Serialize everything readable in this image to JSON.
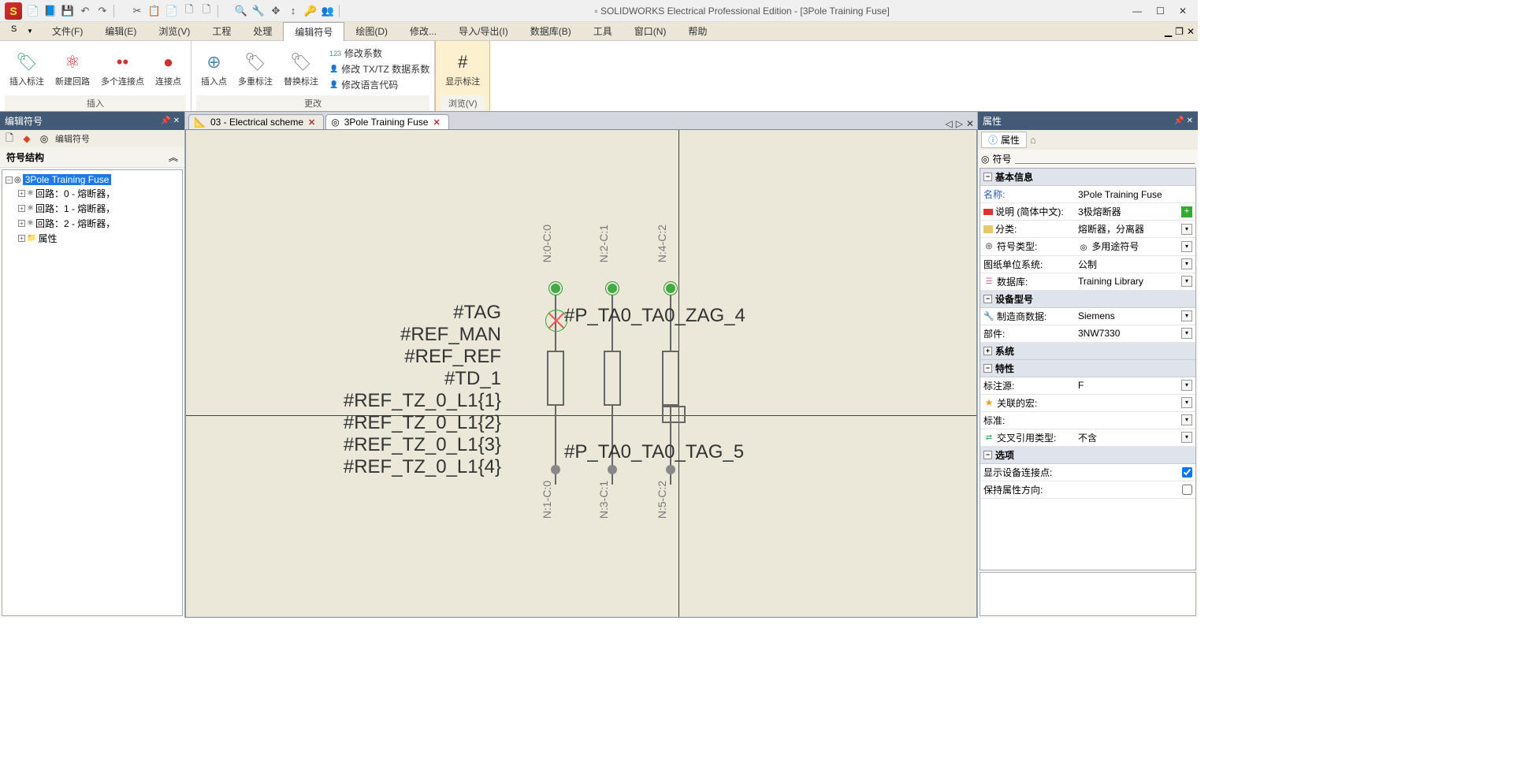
{
  "title": "SOLIDWORKS Electrical Professional Edition - [3Pole Training Fuse]",
  "quickAccess": [
    "📄",
    "📘",
    "💾",
    "↶",
    "↷",
    "",
    "✂",
    "📋",
    "📄",
    "🗋",
    "🗋",
    "",
    "🔍",
    "🔧",
    "✥",
    "↕",
    "🔑",
    "👥",
    ""
  ],
  "menu": {
    "items": [
      "文件(F)",
      "编辑(E)",
      "浏览(V)",
      "工程",
      "处理",
      "编辑符号",
      "绘图(D)",
      "修改...",
      "导入/导出(I)",
      "数据库(B)",
      "工具",
      "窗口(N)",
      "帮助"
    ],
    "activeIndex": 5
  },
  "ribbon": {
    "groups": [
      {
        "label": "插入",
        "buttons": [
          {
            "icon": "🏷",
            "label": "插入标注",
            "color": "#5a8"
          },
          {
            "icon": "⚛",
            "label": "新建回路",
            "color": "#c33"
          },
          {
            "icon": "••",
            "label": "多个连接点",
            "color": "#c33"
          },
          {
            "icon": "●",
            "label": "连接点",
            "color": "#c33"
          }
        ]
      },
      {
        "label": "更改",
        "buttons": [
          {
            "icon": "⊕",
            "label": "插入点",
            "color": "#58a"
          },
          {
            "icon": "🏷",
            "label": "多重标注",
            "color": "#888"
          },
          {
            "icon": "🏷",
            "label": "替换标注",
            "color": "#888"
          }
        ],
        "textItems": [
          {
            "icon": "123",
            "label": "修改系数"
          },
          {
            "icon": "👤",
            "label": "修改 TX/TZ 数据系数"
          },
          {
            "icon": "👤",
            "label": "修改语言代码"
          }
        ]
      },
      {
        "label": "浏览(V)",
        "browse": true,
        "buttons": [
          {
            "icon": "#",
            "label": "显示标注",
            "color": "#333"
          }
        ]
      }
    ]
  },
  "leftPanel": {
    "title": "编辑符号",
    "toolbarLabel": "编辑符号",
    "sectionTitle": "符号结构",
    "tree": [
      {
        "label": "3Pole Training Fuse",
        "selected": true,
        "level": 0,
        "icon": "◎"
      },
      {
        "label": "回路：0 - 熔断器，",
        "level": 1,
        "icon": "⚛"
      },
      {
        "label": "回路：1 - 熔断器，",
        "level": 1,
        "icon": "⚛"
      },
      {
        "label": "回路：2 - 熔断器，",
        "level": 1,
        "icon": "⚛"
      },
      {
        "label": "属性",
        "level": 1,
        "icon": "📁"
      }
    ]
  },
  "docTabs": [
    {
      "label": "03 - Electrical scheme",
      "active": false,
      "icon": "📐"
    },
    {
      "label": "3Pole Training Fuse",
      "active": true,
      "icon": "◎"
    }
  ],
  "canvas": {
    "leftTexts": [
      "#TAG",
      "#REF_MAN",
      "#REF_REF",
      "#TD_1",
      "#REF_TZ_0_L1{1}",
      "#REF_TZ_0_L1{2}",
      "#REF_TZ_0_L1{3}",
      "#REF_TZ_0_L1{4}"
    ],
    "rightTextTop": "#P_TA0_TA0_ZAG_4",
    "rightTextBot": "#P_TA0_TA0_TAG_5",
    "topLabels": [
      "N:0-C:0",
      "N:2-C:1",
      "N:4-C:2"
    ],
    "botLabels": [
      "N:1-C:0",
      "N:3-C:1",
      "N:5-C:2"
    ]
  },
  "rightPanel": {
    "title": "属性",
    "tab1": "属性",
    "searchLabel": "符号",
    "sections": [
      {
        "title": "基本信息",
        "rows": [
          {
            "key": "名称:",
            "val": "3Pole Training Fuse",
            "keyClass": "link"
          },
          {
            "key": "说明 (简体中文):",
            "val": "3极熔断器",
            "icon": "flag",
            "add": true
          },
          {
            "key": "分类:",
            "val": "熔断器，分离器",
            "icon": "folder",
            "drop": true
          },
          {
            "key": "符号类型:",
            "val": "多用途符号",
            "icon": "circ",
            "dropIcon": "circ",
            "drop": true
          },
          {
            "key": "图纸单位系统:",
            "val": "公制",
            "drop": true
          },
          {
            "key": "数据库:",
            "val": "Training Library",
            "icon": "db",
            "drop": true
          }
        ]
      },
      {
        "title": "设备型号",
        "rows": [
          {
            "key": "制造商数据:",
            "val": "Siemens",
            "icon": "wrench",
            "drop": true
          },
          {
            "key": "部件:",
            "val": "3NW7330",
            "drop": true
          }
        ]
      },
      {
        "title": "系统",
        "collapsed": true,
        "rows": []
      },
      {
        "title": "特性",
        "rows": [
          {
            "key": "标注源:",
            "val": "F",
            "drop": true
          },
          {
            "key": "关联的宏:",
            "val": "",
            "icon": "star",
            "drop": true
          },
          {
            "key": "标准:",
            "val": "",
            "drop": true
          },
          {
            "key": "交叉引用类型:",
            "val": "不含",
            "icon": "cross",
            "drop": true
          }
        ]
      },
      {
        "title": "选项",
        "rows": [
          {
            "key": "显示设备连接点:",
            "val": "",
            "check": true,
            "checked": true
          },
          {
            "key": "保持属性方向:",
            "val": "",
            "check": true,
            "checked": false
          }
        ]
      }
    ]
  }
}
